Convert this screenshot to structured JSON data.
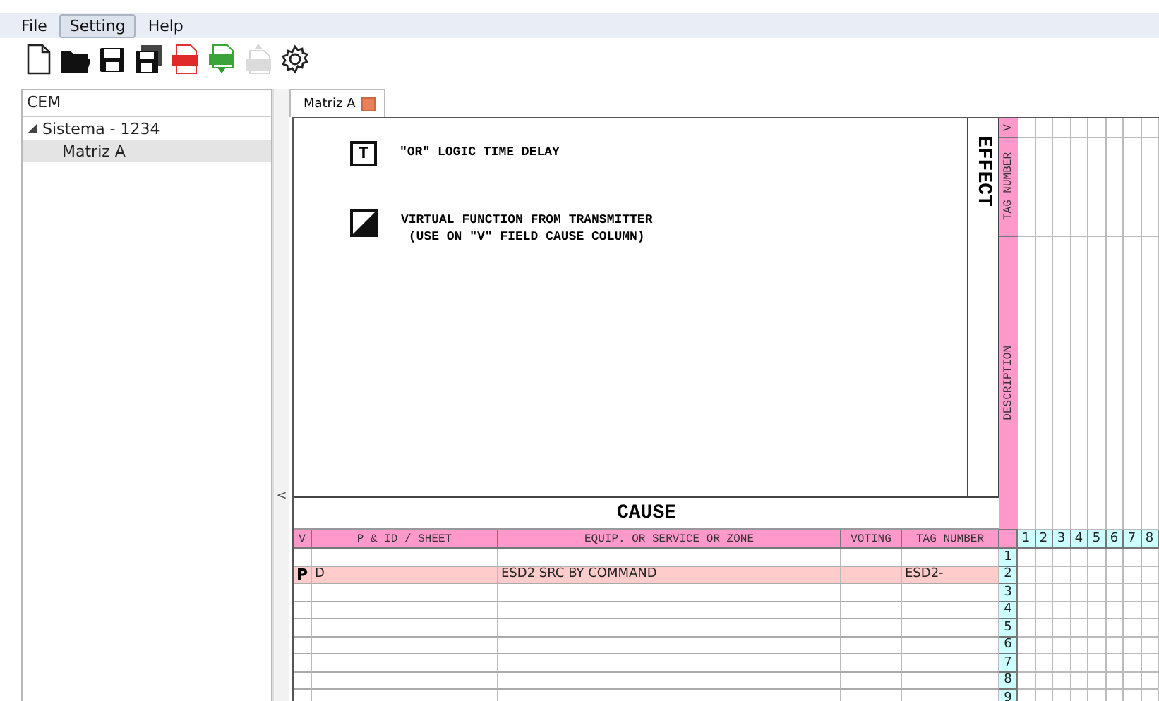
{
  "menu": [
    {
      "label": "File",
      "selected": false
    },
    {
      "label": "Setting",
      "selected": true
    },
    {
      "label": "Help",
      "selected": false
    }
  ],
  "toolbar": [
    {
      "kind": "new",
      "disabled": false
    },
    {
      "kind": "open",
      "disabled": false
    },
    {
      "kind": "save",
      "disabled": false
    },
    {
      "kind": "save-all",
      "disabled": false
    },
    {
      "kind": "pdf",
      "disabled": false
    },
    {
      "kind": "xls-export",
      "disabled": false
    },
    {
      "kind": "xls-import",
      "disabled": true
    },
    {
      "kind": "settings",
      "disabled": false
    }
  ],
  "sidebar": {
    "title": "CEM",
    "tree": [
      {
        "label": "Sistema - 1234",
        "expanded": true,
        "selected": false,
        "children": [
          {
            "label": "Matriz A",
            "selected": true
          }
        ]
      }
    ]
  },
  "splitter": {
    "label": "<"
  },
  "tabs": [
    {
      "label": "Matriz A",
      "selected": true,
      "closable": true
    }
  ],
  "legend": [
    {
      "kind": "time-delay",
      "symbol": "T",
      "lines": [
        "\"OR\" LOGIC TIME DELAY"
      ]
    },
    {
      "kind": "virtual",
      "lines": [
        "VIRTUAL FUNCTION FROM TRANSMITTER",
        "(USE ON \"V\" FIELD CAUSE COLUMN)"
      ]
    }
  ],
  "effect": {
    "title": "EFFECT",
    "headers": [
      "V",
      "TAG NUMBER",
      "DESCRIPTION"
    ],
    "columns": [
      "1",
      "2",
      "3",
      "4",
      "5",
      "6",
      "7",
      "8"
    ]
  },
  "cause": {
    "title": "CAUSE",
    "columns": [
      "V",
      "P & ID / SHEET",
      "EQUIP. OR SERVICE OR ZONE",
      "VOTING",
      "TAG NUMBER"
    ],
    "rows": [
      {
        "number": "1",
        "highlighted": false
      },
      {
        "number": "2",
        "highlighted": true,
        "v": "P",
        "pid": "D",
        "equip": "ESD2 SRC BY COMMAND",
        "tag": "ESD2-"
      },
      {
        "number": "3",
        "highlighted": false
      },
      {
        "number": "4",
        "highlighted": false
      },
      {
        "number": "5",
        "highlighted": false
      },
      {
        "number": "6",
        "highlighted": false
      },
      {
        "number": "7",
        "highlighted": false
      },
      {
        "number": "8",
        "highlighted": false
      },
      {
        "number": "9",
        "highlighted": false
      }
    ]
  }
}
